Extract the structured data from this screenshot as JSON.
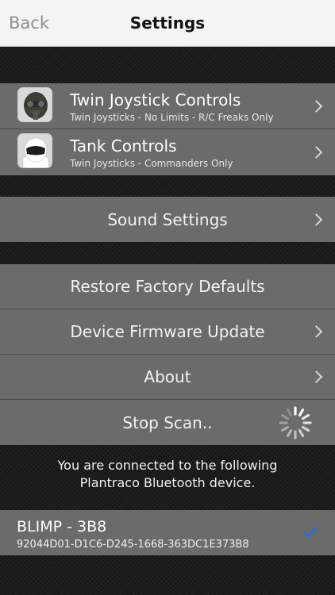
{
  "navbar": {
    "back_label": "Back",
    "title": "Settings"
  },
  "controls": [
    {
      "title": "Twin Joystick Controls",
      "subtitle": "Twin Joysticks - No Limits - R/C Freaks Only",
      "icon": "pilot-helmet-icon"
    },
    {
      "title": "Tank Controls",
      "subtitle": "Twin Joysticks - Commanders Only",
      "icon": "white-helmet-icon"
    }
  ],
  "sound": {
    "label": "Sound Settings"
  },
  "menu": {
    "restore_label": "Restore Factory Defaults",
    "firmware_label": "Device Firmware Update",
    "about_label": "About",
    "stop_scan_label": "Stop Scan.."
  },
  "connection": {
    "line1": "You are connected to the following",
    "line2": "Plantraco Bluetooth device."
  },
  "device": {
    "name": "BLIMP - 3B8",
    "uuid": "92044D01-D1C6-D245-1668-363DC1E373B8",
    "check_color": "#1a73e8"
  },
  "colors": {
    "row_bg": "#6b6b6b",
    "separator": "#4a4a4a",
    "navbar_bg": "#f4f4f4"
  }
}
